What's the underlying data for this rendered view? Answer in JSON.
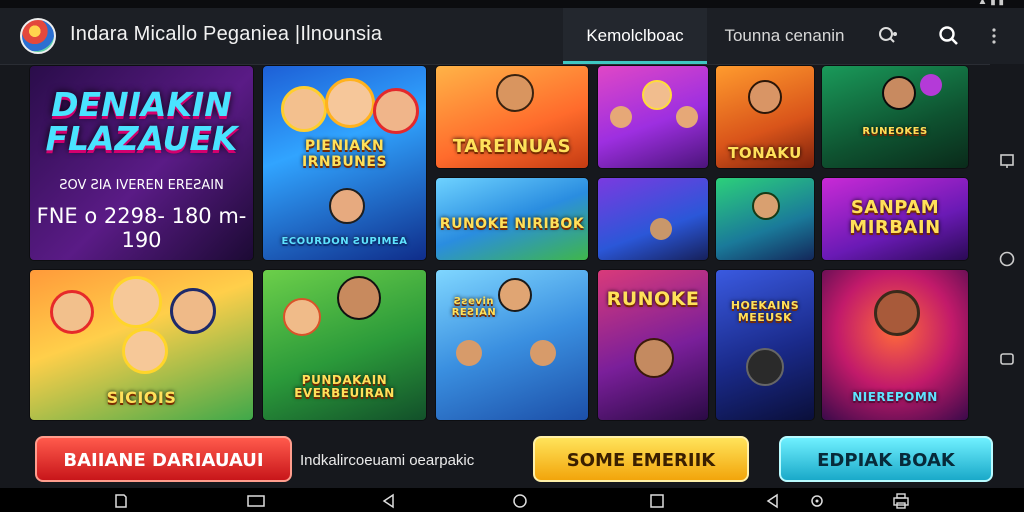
{
  "app": {
    "title": "Indara Micallo Peganiea |Ilnounsia"
  },
  "tabs": [
    {
      "label": "Kemolclboac",
      "active": true
    },
    {
      "label": "Tounna cenanin",
      "active": false
    }
  ],
  "top_icons": [
    "search-settings-icon",
    "search-icon",
    "more-vertical-icon"
  ],
  "hero": {
    "title_line1": "DENIAKIN",
    "title_line2": "FLAZAUEK",
    "subtitle": "ƧOV ƧIA IVEREN EREƧAIN",
    "numbers": "FNE o 2298- 180 m- 190"
  },
  "games": [
    {
      "label": "TAREINUAS"
    },
    {
      "label": "TONAKU"
    },
    {
      "label": "RUNOKE"
    },
    {
      "label": "SANPAM MIRBAIN"
    },
    {
      "label": "SICIOIS"
    },
    {
      "label": "PUNDAKAIN EVERBEUIRAN"
    },
    {
      "label": "HOEKAINS MEEUSK"
    },
    {
      "label": "NIEREPOMN"
    },
    {
      "label": "RUNOKE NIRIBOK"
    },
    {
      "label": "Ƨƨevin REƧIAN"
    },
    {
      "label": "PIENIAKN IRNBUNES"
    },
    {
      "label": "RUNEOKES"
    },
    {
      "label": "ECOURDON ƧUPIMEA"
    }
  ],
  "buttons": {
    "left": "BAIIANE DARIAUAUI",
    "middle_text": "Indkalircoeuami oearpakic",
    "center": "SOME EMERIIK",
    "right": "EDPIAK BOAK"
  },
  "colors": {
    "accent": "#3fc7c2",
    "background": "#16181d",
    "topbar": "#1c1f25"
  }
}
